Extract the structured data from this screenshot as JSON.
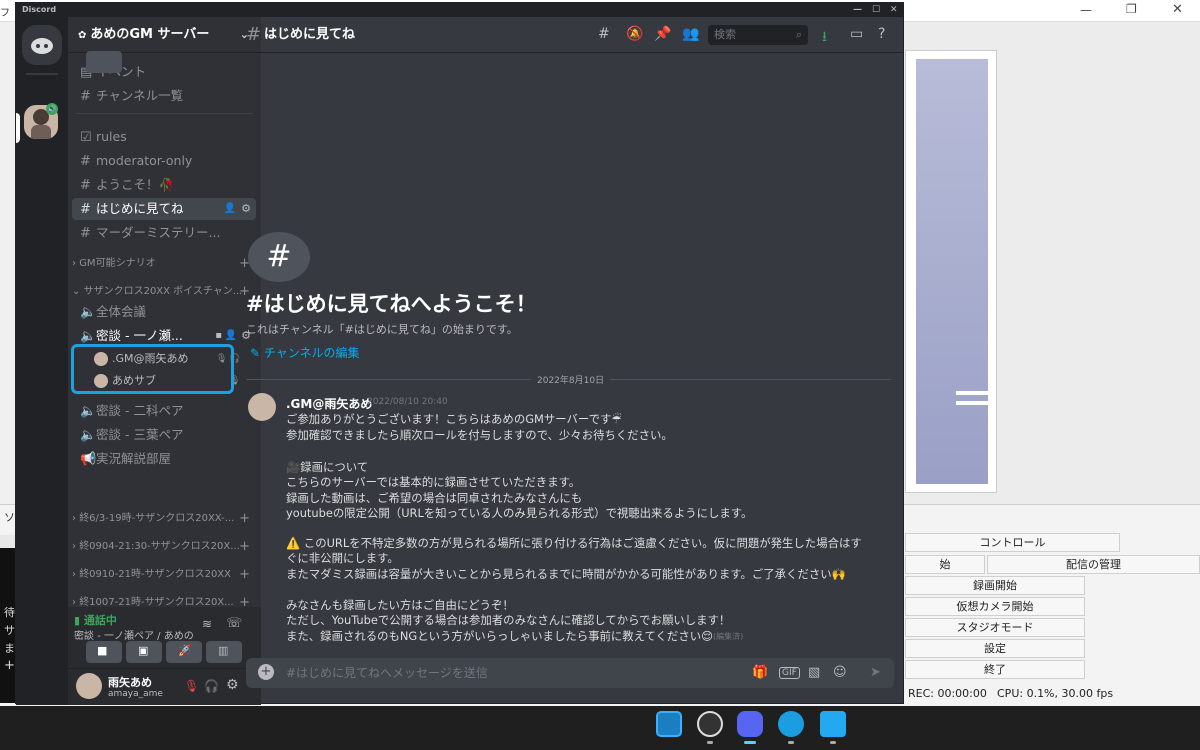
{
  "obs": {
    "right_buttons": [
      "コントロール",
      "配信の管理",
      "録画開始",
      "仮想カメラ開始",
      "スタジオモード",
      "設定",
      "終了"
    ],
    "left_fragment_1": "始",
    "status_rec": "REC: 00:00:00",
    "status_cpu": "CPU: 0.1%, 30.00 fps",
    "left_text_1": "待",
    "left_text_2": "サ",
    "left_text_3": "ま",
    "left_text_4": "ソ",
    "left_text_5": "フ"
  },
  "discord": {
    "window_title": "Discord",
    "server_name": "あめのGM サーバー",
    "top_items": [
      {
        "icon": "calendar-icon",
        "label": "イベント"
      },
      {
        "icon": "channel-list-icon",
        "label": "チャンネル一覧"
      }
    ],
    "channels": [
      {
        "icon": "rules-icon",
        "label": "rules"
      },
      {
        "icon": "hash",
        "label": "moderator-only"
      },
      {
        "icon": "hash",
        "label": "ようこそ！🥀"
      },
      {
        "icon": "hash",
        "label": "はじめに見てね",
        "active": true
      },
      {
        "icon": "hash",
        "label": "マーダーミステリー..."
      }
    ],
    "categories": [
      "GM可能シナリオ",
      "サザンクロス20XX ボイスチャン...",
      "終6/3-19時-サザンクロス20XX-...",
      "終0904-21:30-サザンクロス20X...",
      "終0910-21時-サザンクロス20XX",
      "終1007-21時-サザンクロス20X..."
    ],
    "voice_channels": [
      {
        "label": "全体会議"
      },
      {
        "label": "密談 - 一ノ瀬..."
      },
      {
        "label": "密談 - 二科ペア"
      },
      {
        "label": "密談 - 三葉ペア"
      },
      {
        "label": "実況解説部屋"
      }
    ],
    "voice_users": [
      ".GM@雨矢あめ",
      "あめサブ"
    ],
    "voice_status": "通話中",
    "voice_location": "密談 - 一ノ瀬ペア / あめの...",
    "user_name": "雨矢あめ",
    "user_tag": "amaya_ame",
    "channel_title": "はじめに見てね",
    "search_placeholder": "検索",
    "welcome_title": "#はじめに見てねへようこそ！",
    "welcome_sub": "これはチャンネル「#はじめに見てね」の始まりです。",
    "edit_channel": "チャンネルの編集",
    "date_divider": "2022年8月10日",
    "message": {
      "author": ".GM@雨矢あめ",
      "time": "2022/08/10 20:40",
      "lines": [
        "ご参加ありがとうございます！こちらはあめのGMサーバーです☔",
        "参加確認できましたら順次ロールを付与しますので、少々お待ちください。",
        "",
        "🎥録画について",
        "こちらのサーバーでは基本的に録画させていただきます。",
        "録画した動画は、ご希望の場合は同卓されたみなさんにも",
        "youtubeの限定公開（URLを知っている人のみ見られる形式）で視聴出来るようにします。",
        "",
        "⚠️ このURLを不特定多数の方が見られる場所に張り付ける行為はご遠慮ください。仮に問題が発生した場合はす",
        "ぐに非公開にします。",
        "またマダミス録画は容量が大きいことから見られるまでに時間がかかる可能性があります。ご了承ください🙌",
        "",
        "みなさんも録画したい方はご自由にどうぞ！",
        "ただし、YouTubeで公開する場合は参加者のみなさんに確認してからでお願いします！",
        "また、録画されるのもNGという方がいらっしゃいましたら事前に教えてください😌"
      ],
      "edited": "(編集済)"
    },
    "composer_placeholder": "#はじめに見てねへメッセージを送信",
    "gif_label": "GIF"
  }
}
